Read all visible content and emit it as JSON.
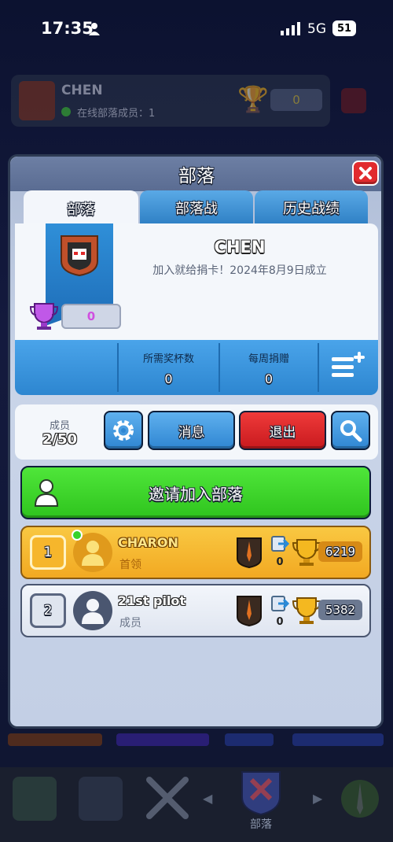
{
  "status": {
    "time": "17:35",
    "network": "5G",
    "battery": "51"
  },
  "bg_header": {
    "clan_name": "CHEN",
    "online_text": "在线部落成员：1",
    "trophies": "0"
  },
  "panel": {
    "title": "部落",
    "tabs": [
      {
        "label": "部落"
      },
      {
        "label": "部落战"
      },
      {
        "label": "历史战绩"
      }
    ],
    "clan": {
      "name": "CHEN",
      "description": "加入就给捐卡！2024年8月9日成立",
      "trophies": "0"
    },
    "stats": {
      "required_label": "所需奖杯数",
      "required_value": "0",
      "weekly_label": "每周捐赠",
      "weekly_value": "0"
    },
    "members": {
      "label": "成员",
      "count": "2/50"
    },
    "buttons": {
      "chat": "消息",
      "leave": "退出"
    },
    "invite_label": "邀请加入部落",
    "member_list": [
      {
        "rank": "1",
        "name": "CHARON",
        "role": "首领",
        "donations": "0",
        "trophies": "6219",
        "online": true
      },
      {
        "rank": "2",
        "name": "21st pilot",
        "role": "成员",
        "donations": "0",
        "trophies": "5382",
        "online": false
      }
    ]
  },
  "bottom_nav": {
    "active_label": "部落"
  },
  "colors": {
    "accent_blue": "#3aa0e8",
    "invite_green": "#3ddc2a",
    "leave_red": "#e0262a",
    "leader_gold": "#f6b62c"
  }
}
